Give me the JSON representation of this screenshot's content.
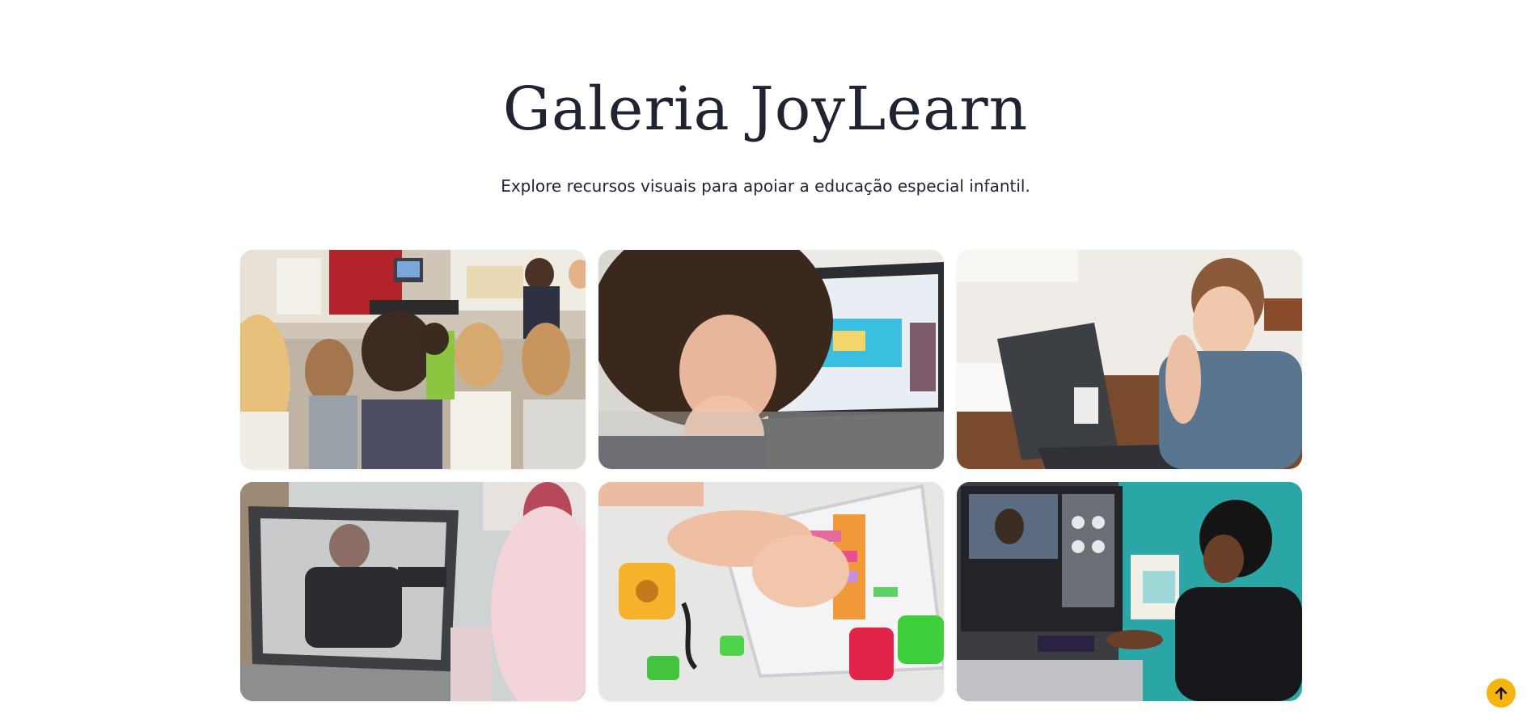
{
  "hero": {
    "title": "Galeria JoyLearn",
    "subtitle": "Explore recursos visuais para apoiar a educação especial infantil."
  },
  "gallery": {
    "items": [
      {
        "name": "children-listening-story-photo"
      },
      {
        "name": "child-watching-laptop-class-photo"
      },
      {
        "name": "boy-bored-at-laptop-photo"
      },
      {
        "name": "online-teacher-laptop-photo"
      },
      {
        "name": "tablet-coding-blocks-photo"
      },
      {
        "name": "boy-at-computer-videocall-photo"
      }
    ]
  },
  "scroll_top": {
    "icon": "arrow-up-icon",
    "color": "#f5b50f"
  }
}
